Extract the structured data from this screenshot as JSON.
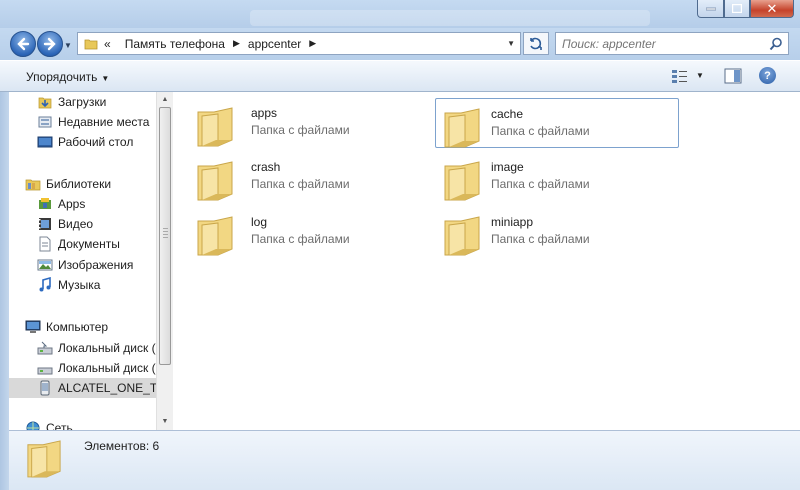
{
  "window": {
    "close_glyph": "✕"
  },
  "address": {
    "overflow": "«",
    "crumbs": [
      "Память телефона",
      "appcenter"
    ],
    "separator": "▶",
    "dropdown": "▼"
  },
  "search": {
    "placeholder": "Поиск: appcenter"
  },
  "toolbar": {
    "organize_label": "Упорядочить",
    "organize_arrow": "▼",
    "views_arrow": "▼",
    "help_label": "?"
  },
  "nav": {
    "items": [
      {
        "label": "Загрузки",
        "icon": "downloads-icon"
      },
      {
        "label": "Недавние места",
        "icon": "recent-places-icon"
      },
      {
        "label": "Рабочий стол",
        "icon": "desktop-icon"
      },
      {
        "label": "Библиотеки",
        "icon": "libraries-icon"
      },
      {
        "label": "Apps",
        "icon": "apps-library-icon"
      },
      {
        "label": "Видео",
        "icon": "video-icon"
      },
      {
        "label": "Документы",
        "icon": "documents-icon"
      },
      {
        "label": "Изображения",
        "icon": "pictures-icon"
      },
      {
        "label": "Музыка",
        "icon": "music-icon"
      },
      {
        "label": "Компьютер",
        "icon": "computer-icon"
      },
      {
        "label": "Локальный диск (",
        "icon": "local-disk-icon"
      },
      {
        "label": "Локальный диск (",
        "icon": "local-disk-icon"
      },
      {
        "label": "ALCATEL_ONE_TO",
        "icon": "portable-device-icon"
      },
      {
        "label": "Сеть",
        "icon": "network-icon"
      }
    ]
  },
  "folders": [
    {
      "name": "apps",
      "type": "Папка с файлами"
    },
    {
      "name": "cache",
      "type": "Папка с файлами"
    },
    {
      "name": "crash",
      "type": "Папка с файлами"
    },
    {
      "name": "image",
      "type": "Папка с файлами"
    },
    {
      "name": "log",
      "type": "Папка с файлами"
    },
    {
      "name": "miniapp",
      "type": "Папка с файлами"
    }
  ],
  "status": {
    "count_text": "Элементов: 6"
  }
}
